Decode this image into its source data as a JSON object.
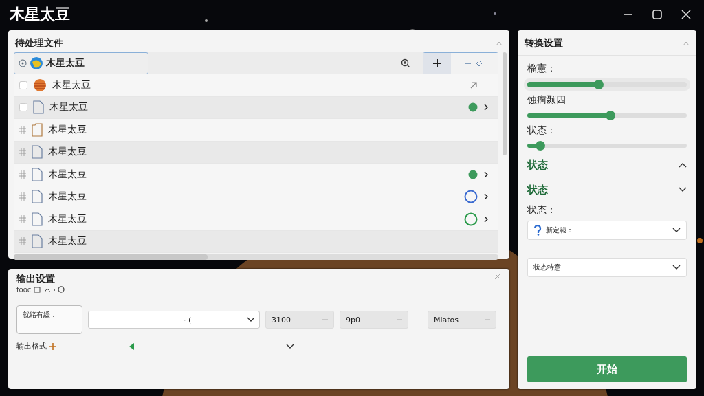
{
  "window": {
    "title": "木星太豆"
  },
  "files": {
    "title": "待处理文件",
    "search": {
      "value": "木星太豆"
    },
    "rows": [
      {
        "kind": "planet",
        "name": "木星太豆",
        "checked": false,
        "highlighted": false
      },
      {
        "kind": "file",
        "name": "木星太豆",
        "checked": false,
        "color": "#3d9a5c",
        "filled": true,
        "highlighted": true
      },
      {
        "kind": "folder",
        "name": "木星太豆",
        "highlighted": false
      },
      {
        "kind": "file",
        "name": "木星太豆",
        "highlighted": true
      },
      {
        "kind": "file",
        "name": "木星太豆",
        "color": "#3d9a5c",
        "filled": true,
        "highlighted": false
      },
      {
        "kind": "file",
        "name": "木星太豆",
        "color": "#3a6ad0",
        "filled": false,
        "highlighted": false
      },
      {
        "kind": "file",
        "name": "木星太豆",
        "color": "#2a9a4a",
        "filled": false,
        "highlighted": false
      },
      {
        "kind": "file",
        "name": "木星太豆",
        "highlighted": true
      }
    ]
  },
  "output": {
    "title": "输出设置",
    "subtitle": "fooc",
    "label": "就緒有緩：",
    "dropdown_value": "· (",
    "fields": [
      "3100",
      "9p0",
      "Mlatos"
    ],
    "format_label": "输出格式"
  },
  "convert": {
    "title": "转换设置",
    "sliders": [
      {
        "label": "榴憲：",
        "level": 0.45
      },
      {
        "label": "蚀痾颞四",
        "level": 0.52
      },
      {
        "label": "状态：",
        "level": 0.08
      }
    ],
    "sections": [
      {
        "label": "状态",
        "expanded": true
      },
      {
        "label": "状态",
        "expanded": false
      }
    ],
    "status_label": "状态：",
    "selects": [
      "新定範：",
      "状态特意"
    ],
    "start": "开始"
  }
}
